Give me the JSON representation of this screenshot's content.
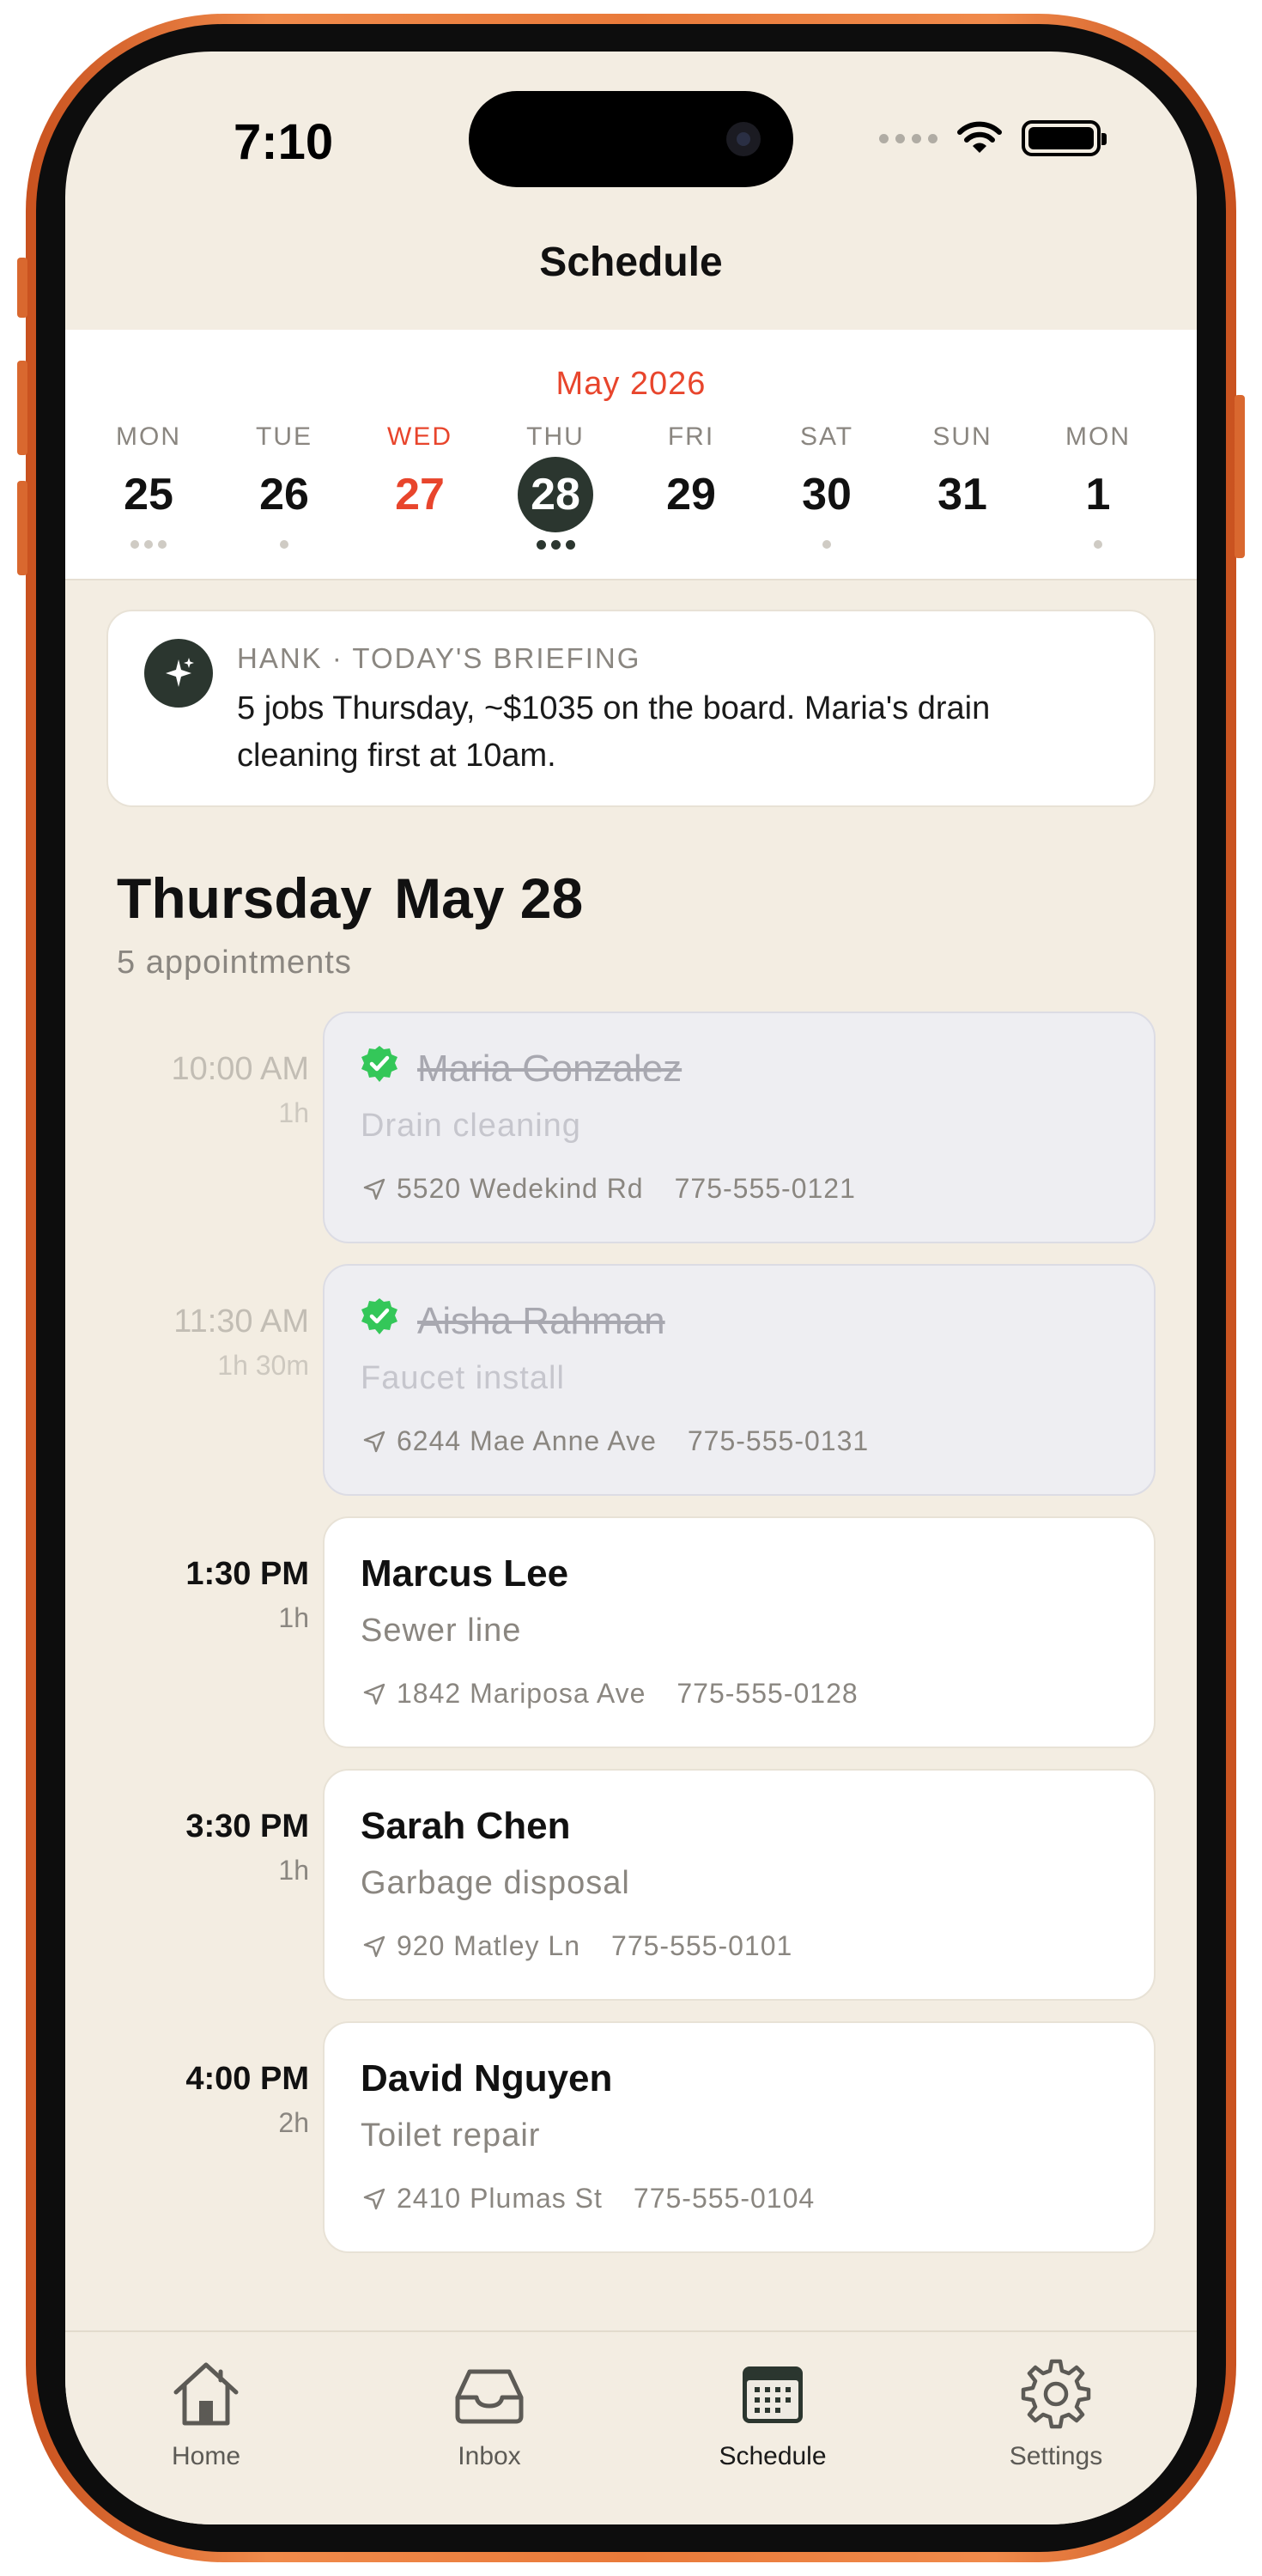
{
  "status_bar": {
    "time": "7:10"
  },
  "nav": {
    "title": "Schedule"
  },
  "week": {
    "month": "May 2026",
    "days": [
      {
        "name": "MON",
        "num": "25"
      },
      {
        "name": "TUE",
        "num": "26"
      },
      {
        "name": "WED",
        "num": "27"
      },
      {
        "name": "THU",
        "num": "28"
      },
      {
        "name": "FRI",
        "num": "29"
      },
      {
        "name": "SAT",
        "num": "30"
      },
      {
        "name": "SUN",
        "num": "31"
      },
      {
        "name": "MON",
        "num": "1"
      }
    ]
  },
  "briefing": {
    "tag": "HANK · TODAY'S BRIEFING",
    "text": "5 jobs Thursday, ~$1035 on the board. Maria's drain cleaning first at 10am."
  },
  "day_heading": {
    "weekday": "Thursday",
    "date": "May 28",
    "count": "5 appointments"
  },
  "appointments": [
    {
      "time": "10:00 AM",
      "duration": "1h",
      "name": "Maria Gonzalez",
      "service": "Drain cleaning",
      "address": "5520 Wedekind Rd",
      "phone": "775-555-0121",
      "completed": true
    },
    {
      "time": "11:30 AM",
      "duration": "1h 30m",
      "name": "Aisha Rahman",
      "service": "Faucet install",
      "address": "6244 Mae Anne Ave",
      "phone": "775-555-0131",
      "completed": true
    },
    {
      "time": "1:30 PM",
      "duration": "1h",
      "name": "Marcus Lee",
      "service": "Sewer line",
      "address": "1842 Mariposa Ave",
      "phone": "775-555-0128",
      "completed": false
    },
    {
      "time": "3:30 PM",
      "duration": "1h",
      "name": "Sarah Chen",
      "service": "Garbage disposal",
      "address": "920 Matley Ln",
      "phone": "775-555-0101",
      "completed": false
    },
    {
      "time": "4:00 PM",
      "duration": "2h",
      "name": "David Nguyen",
      "service": "Toilet repair",
      "address": "2410 Plumas St",
      "phone": "775-555-0104",
      "completed": false
    }
  ],
  "tabs": [
    {
      "label": "Home",
      "icon": "house-icon"
    },
    {
      "label": "Inbox",
      "icon": "inbox-tray-icon"
    },
    {
      "label": "Schedule",
      "icon": "calendar-icon"
    },
    {
      "label": "Settings",
      "icon": "gear-icon"
    }
  ],
  "colors": {
    "accent_red": "#e8452c",
    "dark_green": "#2b362f",
    "background": "#f3ede2",
    "check_green": "#34c759",
    "frame_orange": "#e97a3a"
  }
}
